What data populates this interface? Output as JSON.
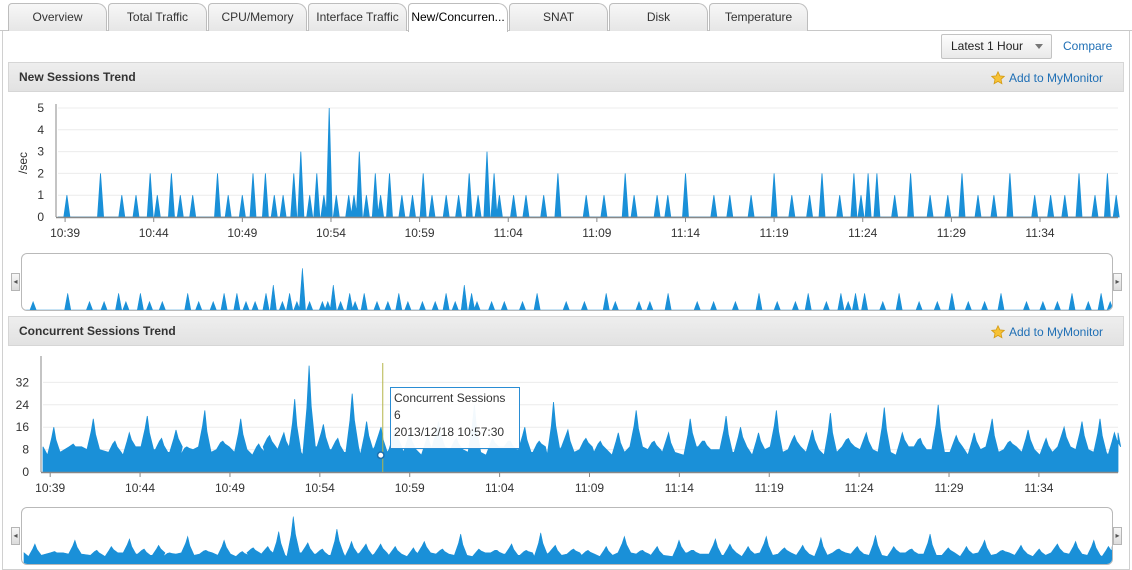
{
  "tabs": [
    {
      "label": "Overview",
      "active": false
    },
    {
      "label": "Total Traffic",
      "active": false
    },
    {
      "label": "CPU/Memory",
      "active": false
    },
    {
      "label": "Interface Traffic",
      "active": false
    },
    {
      "label": "New/Concurren...",
      "active": true
    },
    {
      "label": "SNAT",
      "active": false
    },
    {
      "label": "Disk",
      "active": false
    },
    {
      "label": "Temperature",
      "active": false
    }
  ],
  "toolbar": {
    "time_range": "Latest 1 Hour",
    "compare_label": "Compare"
  },
  "colors": {
    "series": "#1a90d8",
    "link": "#1f6fb5",
    "crosshair": "#b5b54a"
  },
  "panels": {
    "new_sessions": {
      "title": "New Sessions Trend",
      "monitor_label": "Add to MyMonitor"
    },
    "concurrent_sessions": {
      "title": "Concurrent Sessions Trend",
      "monitor_label": "Add to MyMonitor"
    }
  },
  "tooltip": {
    "series_name": "Concurrent Sessions",
    "value": "6",
    "time": "2013/12/18 10:57:30"
  },
  "chart_data": [
    {
      "type": "area",
      "title": "New Sessions Trend",
      "xlabel": "",
      "ylabel": "/sec",
      "ylim": [
        0,
        5
      ],
      "y_ticks": [
        "0",
        "1",
        "2",
        "3",
        "4",
        "5"
      ],
      "x_ticks": [
        "10:39",
        "10:44",
        "10:49",
        "10:54",
        "10:59",
        "11:04",
        "11:09",
        "11:14",
        "11:19",
        "11:24",
        "11:29",
        "11:34"
      ],
      "x_range_minutes": [
        38.6,
        98.4
      ],
      "spikes": [
        [
          39.1,
          1
        ],
        [
          41.0,
          2
        ],
        [
          42.2,
          1
        ],
        [
          43.0,
          1
        ],
        [
          43.8,
          2
        ],
        [
          44.2,
          1
        ],
        [
          45.0,
          2
        ],
        [
          45.5,
          1
        ],
        [
          46.2,
          1
        ],
        [
          47.6,
          2
        ],
        [
          48.2,
          1
        ],
        [
          49.0,
          1
        ],
        [
          49.6,
          2
        ],
        [
          50.3,
          2
        ],
        [
          50.8,
          1
        ],
        [
          51.3,
          1
        ],
        [
          51.9,
          2
        ],
        [
          52.3,
          3
        ],
        [
          52.8,
          1
        ],
        [
          53.2,
          2
        ],
        [
          53.6,
          1
        ],
        [
          53.9,
          5
        ],
        [
          54.3,
          1
        ],
        [
          55.0,
          1
        ],
        [
          55.3,
          1
        ],
        [
          55.6,
          3
        ],
        [
          56.0,
          1
        ],
        [
          56.5,
          2
        ],
        [
          56.8,
          1
        ],
        [
          57.3,
          2
        ],
        [
          58.0,
          1
        ],
        [
          58.6,
          1
        ],
        [
          59.2,
          2
        ],
        [
          59.7,
          1
        ],
        [
          60.5,
          1
        ],
        [
          61.2,
          1
        ],
        [
          61.8,
          2
        ],
        [
          62.3,
          1
        ],
        [
          62.8,
          3
        ],
        [
          63.2,
          2
        ],
        [
          63.5,
          1
        ],
        [
          64.3,
          1
        ],
        [
          65.0,
          1
        ],
        [
          66.0,
          1
        ],
        [
          66.8,
          2
        ],
        [
          68.4,
          1
        ],
        [
          69.4,
          1
        ],
        [
          70.6,
          2
        ],
        [
          71.1,
          1
        ],
        [
          72.4,
          1
        ],
        [
          73.0,
          1
        ],
        [
          74.0,
          2
        ],
        [
          75.6,
          1
        ],
        [
          76.5,
          1
        ],
        [
          77.7,
          1
        ],
        [
          79.0,
          2
        ],
        [
          80.0,
          1
        ],
        [
          81.0,
          1
        ],
        [
          81.7,
          2
        ],
        [
          82.7,
          1
        ],
        [
          83.5,
          2
        ],
        [
          83.9,
          1
        ],
        [
          84.3,
          2
        ],
        [
          84.8,
          2
        ],
        [
          85.8,
          1
        ],
        [
          86.7,
          2
        ],
        [
          87.8,
          1
        ],
        [
          88.8,
          1
        ],
        [
          89.6,
          2
        ],
        [
          90.5,
          1
        ],
        [
          91.4,
          1
        ],
        [
          92.3,
          2
        ],
        [
          93.7,
          1
        ],
        [
          94.6,
          1
        ],
        [
          95.4,
          1
        ],
        [
          96.2,
          2
        ],
        [
          97.1,
          1
        ],
        [
          97.8,
          2
        ],
        [
          98.3,
          1
        ]
      ]
    },
    {
      "type": "area",
      "title": "Concurrent Sessions Trend",
      "xlabel": "",
      "ylabel": "",
      "ylim": [
        0,
        40
      ],
      "y_ticks": [
        "0",
        "8",
        "16",
        "24",
        "32"
      ],
      "x_ticks": [
        "10:39",
        "10:44",
        "10:49",
        "10:54",
        "10:59",
        "11:04",
        "11:09",
        "11:14",
        "11:19",
        "11:24",
        "11:29",
        "11:34"
      ],
      "x_range_minutes": [
        38.6,
        98.4
      ],
      "baseline": 6,
      "peaks": [
        [
          39.2,
          16
        ],
        [
          40.4,
          9
        ],
        [
          41.4,
          19
        ],
        [
          42.6,
          11
        ],
        [
          43.4,
          14
        ],
        [
          44.4,
          20
        ],
        [
          45.2,
          12
        ],
        [
          46.0,
          15
        ],
        [
          46.6,
          9
        ],
        [
          47.6,
          22
        ],
        [
          48.6,
          11
        ],
        [
          49.6,
          19
        ],
        [
          50.6,
          10
        ],
        [
          51.2,
          13
        ],
        [
          52.0,
          14
        ],
        [
          52.6,
          26
        ],
        [
          53.4,
          38
        ],
        [
          54.2,
          17
        ],
        [
          55.0,
          12
        ],
        [
          55.8,
          28
        ],
        [
          56.6,
          18
        ],
        [
          57.4,
          16
        ],
        [
          58.2,
          16
        ],
        [
          59.0,
          14
        ],
        [
          60.0,
          13
        ],
        [
          60.6,
          18
        ],
        [
          61.6,
          12
        ],
        [
          62.6,
          24
        ],
        [
          63.6,
          12
        ],
        [
          64.6,
          11
        ],
        [
          65.4,
          16
        ],
        [
          66.2,
          11
        ],
        [
          67.0,
          25
        ],
        [
          67.8,
          15
        ],
        [
          68.8,
          12
        ],
        [
          69.6,
          11
        ],
        [
          70.6,
          14
        ],
        [
          71.6,
          22
        ],
        [
          72.6,
          11
        ],
        [
          73.4,
          14
        ],
        [
          74.6,
          19
        ],
        [
          75.4,
          11
        ],
        [
          76.6,
          20
        ],
        [
          77.4,
          16
        ],
        [
          78.4,
          14
        ],
        [
          79.4,
          22
        ],
        [
          80.4,
          13
        ],
        [
          81.4,
          15
        ],
        [
          82.4,
          21
        ],
        [
          83.4,
          12
        ],
        [
          84.4,
          14
        ],
        [
          85.4,
          23
        ],
        [
          86.4,
          14
        ],
        [
          87.4,
          12
        ],
        [
          88.4,
          24
        ],
        [
          89.4,
          13
        ],
        [
          90.4,
          14
        ],
        [
          91.4,
          19
        ],
        [
          92.4,
          11
        ],
        [
          93.4,
          15
        ],
        [
          94.4,
          12
        ],
        [
          95.4,
          16
        ],
        [
          96.4,
          18
        ],
        [
          97.4,
          19
        ],
        [
          98.2,
          14
        ]
      ],
      "highlight": {
        "time": "2013/12/18 10:57:30",
        "value": 6
      }
    }
  ]
}
